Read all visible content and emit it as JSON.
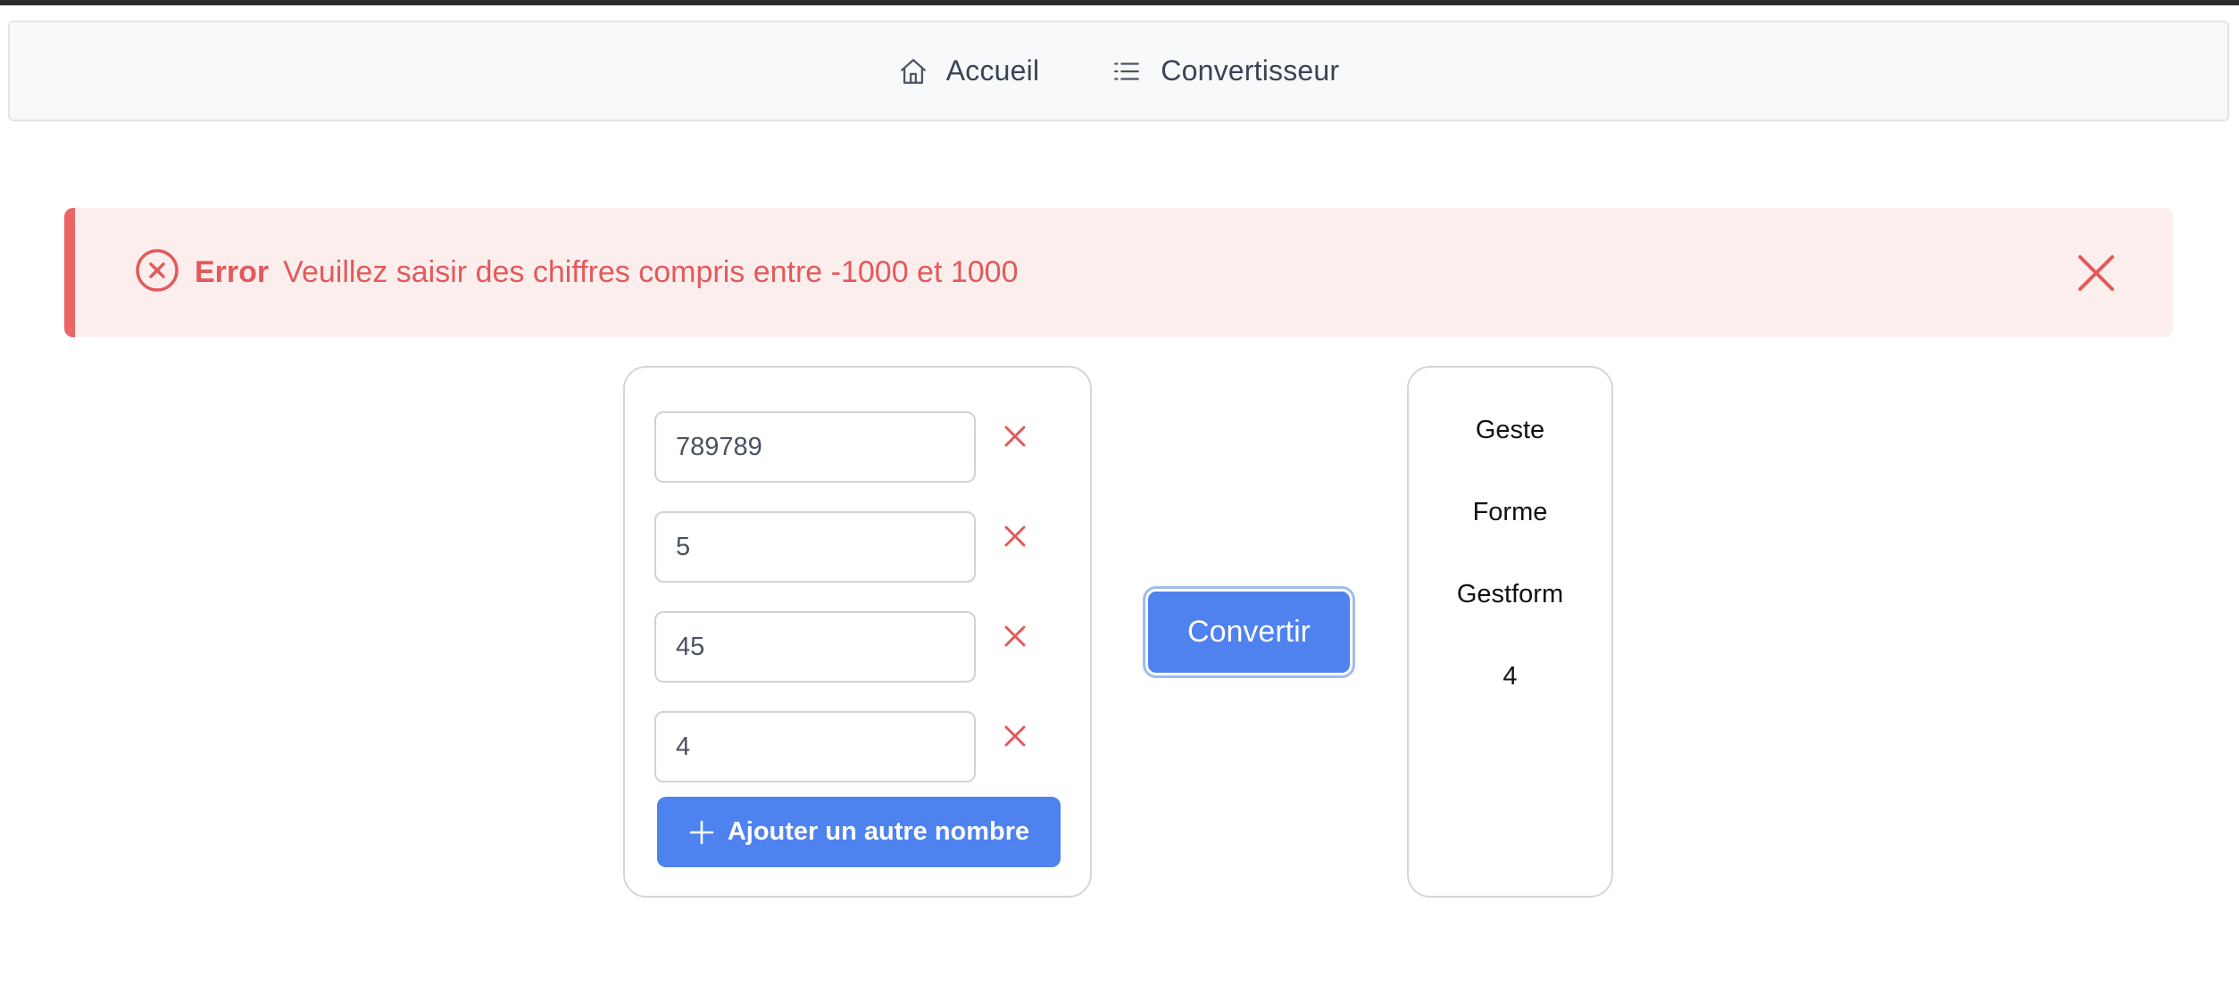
{
  "nav": {
    "items": [
      {
        "label": "Accueil",
        "icon": "home-icon"
      },
      {
        "label": "Convertisseur",
        "icon": "list-icon"
      }
    ]
  },
  "alert": {
    "title": "Error",
    "message": "Veuillez saisir des chiffres compris entre -1000 et 1000",
    "icon": "error-circle-icon",
    "color": "#e25a5a",
    "background": "#fdeeee"
  },
  "inputs": {
    "values": [
      "789789",
      "5",
      "45",
      "4"
    ],
    "add_label": "Ajouter un autre nombre"
  },
  "convert_label": "Convertir",
  "results": [
    "Geste",
    "Forme",
    "Gestform",
    "4"
  ],
  "colors": {
    "primary": "#4e82ee",
    "danger": "#e25a5a"
  }
}
